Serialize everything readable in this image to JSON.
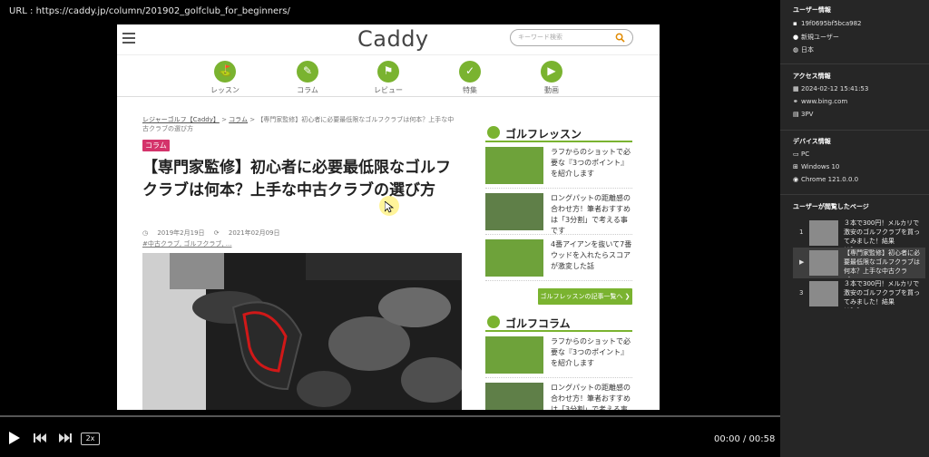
{
  "url_bar": "URL : https://caddy.jp/column/201902_golfclub_for_beginners/",
  "site": {
    "logo": "Caddy",
    "search_placeholder": "キーワード検索",
    "nav": [
      {
        "label": "レッスン",
        "icon": "golfer-icon"
      },
      {
        "label": "コラム",
        "icon": "pen-icon"
      },
      {
        "label": "レビュー",
        "icon": "golf-bag-icon"
      },
      {
        "label": "特集",
        "icon": "thumbs-up-icon"
      },
      {
        "label": "動画",
        "icon": "video-icon"
      }
    ],
    "breadcrumb": {
      "home": "レジャーゴルフ【Caddy】",
      "sep1": " > ",
      "category": "コラム",
      "sep2": " > ",
      "current": "【専門家監修】初心者に必要最低限なゴルフクラブは何本？上手な中古クラブの選び方"
    },
    "category_badge": "コラム",
    "headline": "【専門家監修】初心者に必要最低限なゴルフクラブは何本？上手な中古クラブの選び方",
    "published": "2019年2月19日",
    "updated": "2021年02月09日",
    "tags": "#中古クラブ, ゴルフクラブ, ...",
    "sidebar": {
      "lesson_title": "ゴルフレッスン",
      "lesson_items": [
        "ラフからのショットで必要な『3つのポイント』を紹介します",
        "ロングパットの距離感の合わせ方！筆者おすすめは「3分割」で考える事です",
        "4番アイアンを抜いて7番ウッドを入れたらスコアが激変した話"
      ],
      "lesson_more": "ゴルフレッスンの記事一覧へ ❯",
      "column_title": "ゴルフコラム",
      "column_items": [
        "ラフからのショットで必要な『3つのポイント』を紹介します",
        "ロングパットの距離感の合わせ方！筆者おすすめは「3分割」で考える事です"
      ]
    }
  },
  "player": {
    "speed": "2x",
    "time": "00:00 / 00:58",
    "progress": 0
  },
  "panel": {
    "user_title": "ユーザー情報",
    "user_id": "19f0695bf5bca982",
    "user_type": "新規ユーザー",
    "country": "日本",
    "access_title": "アクセス情報",
    "access_time": "2024-02-12 15:41:53",
    "referrer": "www.bing.com",
    "pageviews": "3PV",
    "device_title": "デバイス情報",
    "device": "PC",
    "os": "Windows 10",
    "browser": "Chrome 121.0.0.0",
    "history_title": "ユーザーが閲覧したページ",
    "history": [
      {
        "num": "1",
        "title": "３本で300円！メルカリで激安のゴルフクラブを買ってみました！結果は？・・・"
      },
      {
        "num": "▶",
        "title": "【専門家監修】初心者に必要最低限なゴルフクラブは何本？上手な中古クラブ・・・"
      },
      {
        "num": "3",
        "title": "３本で300円！メルカリで激安のゴルフクラブを買ってみました！結果は？？・・・"
      }
    ]
  }
}
